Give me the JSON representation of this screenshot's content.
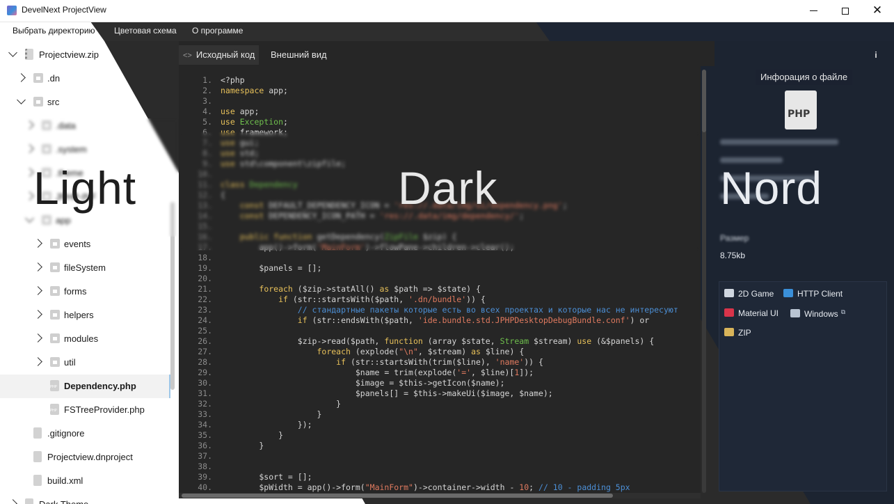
{
  "window": {
    "title": "DevelNext ProjectView",
    "minimize_glyph": "",
    "maximize_glyph": "",
    "close_glyph": "✕"
  },
  "menu": {
    "items": [
      "Выбрать директорию",
      "Цветовая схема",
      "О программе"
    ]
  },
  "tree": {
    "items": [
      {
        "label": "Projectview.zip",
        "type": "zip"
      },
      {
        "label": ".dn",
        "type": "folder"
      },
      {
        "label": "src",
        "type": "folder"
      },
      {
        "label": ".data",
        "type": "folder"
      },
      {
        "label": ".system",
        "type": "folder"
      },
      {
        "label": ".theme",
        "type": "folder"
      },
      {
        "label": "JPHP-INF",
        "type": "folder"
      },
      {
        "label": "app",
        "type": "folder"
      },
      {
        "label": "events",
        "type": "folder"
      },
      {
        "label": "fileSystem",
        "type": "folder"
      },
      {
        "label": "forms",
        "type": "folder"
      },
      {
        "label": "helpers",
        "type": "folder"
      },
      {
        "label": "modules",
        "type": "folder"
      },
      {
        "label": "util",
        "type": "folder"
      },
      {
        "label": "Dependency.php",
        "type": "php",
        "selected": true
      },
      {
        "label": "FSTreeProvider.php",
        "type": "php"
      },
      {
        "label": ".gitignore",
        "type": "doc"
      },
      {
        "label": "Projectview.dnproject",
        "type": "doc"
      },
      {
        "label": "build.xml",
        "type": "doc"
      },
      {
        "label": "Dark Theme",
        "type": "doc"
      }
    ]
  },
  "tabs": {
    "source": "Исходный код",
    "source_icon": "<>",
    "view": "Внешний вид"
  },
  "info": {
    "button": "i",
    "title": "Инфорация о файле",
    "file_type": "PHP",
    "size_label": "Размер",
    "size_value": "8.75kb",
    "plugins": [
      {
        "label": "2D Game",
        "icon": "gamepad-icon"
      },
      {
        "label": "HTTP Client",
        "icon": "http-icon"
      },
      {
        "label": "Material UI",
        "icon": "material-icon"
      },
      {
        "label": "Windows",
        "icon": "windows-icon",
        "ext": "⧉"
      },
      {
        "label": "ZIP",
        "icon": "zip-icon"
      }
    ]
  },
  "themes": {
    "light": "Light",
    "dark": "Dark",
    "nord": "Nord"
  },
  "code": [
    {
      "n": "1.",
      "t": [
        [
          "",
          "<?php"
        ]
      ]
    },
    {
      "n": "2.",
      "t": [
        [
          "kw",
          "namespace"
        ],
        [
          "",
          " app;"
        ]
      ]
    },
    {
      "n": "3.",
      "t": []
    },
    {
      "n": "4.",
      "t": [
        [
          "kw",
          "use"
        ],
        [
          "",
          " app;"
        ]
      ]
    },
    {
      "n": "5.",
      "t": [
        [
          "kw",
          "use"
        ],
        [
          "cls",
          " Exception"
        ],
        [
          "",
          ";"
        ]
      ]
    },
    {
      "n": "6.",
      "t": [
        [
          "kw",
          "use"
        ],
        [
          "",
          " framework;"
        ]
      ]
    },
    {
      "n": "7.",
      "t": [
        [
          "kw",
          "use"
        ],
        [
          "",
          " gui;"
        ]
      ]
    },
    {
      "n": "8.",
      "t": [
        [
          "kw",
          "use"
        ],
        [
          "",
          " std;"
        ]
      ]
    },
    {
      "n": "9.",
      "t": [
        [
          "kw",
          "use"
        ],
        [
          "",
          " std\\component\\zipfile;"
        ]
      ]
    },
    {
      "n": "10.",
      "t": []
    },
    {
      "n": "11.",
      "t": [
        [
          "kw",
          "class"
        ],
        [
          "cls",
          " Dependency"
        ]
      ]
    },
    {
      "n": "12.",
      "t": [
        [
          "",
          "{"
        ]
      ]
    },
    {
      "n": "13.",
      "t": [
        [
          "",
          "    "
        ],
        [
          "kw",
          "const"
        ],
        [
          "",
          " DEFAULT_DEPENDENCY_ICON = "
        ],
        [
          "str",
          "'res://.data/img/ui/dependency.png'"
        ],
        [
          "",
          ";"
        ]
      ]
    },
    {
      "n": "14.",
      "t": [
        [
          "",
          "    "
        ],
        [
          "kw",
          "const"
        ],
        [
          "",
          " DEPENDENCY_ICON_PATH = "
        ],
        [
          "str",
          "'res://.data/img/dependency/'"
        ],
        [
          "",
          ";"
        ]
      ]
    },
    {
      "n": "15.",
      "t": []
    },
    {
      "n": "16.",
      "t": [
        [
          "",
          "    "
        ],
        [
          "kw",
          "public function"
        ],
        [
          "",
          " getDependency("
        ],
        [
          "cls",
          "ZipFile"
        ],
        [
          "",
          " $zip) {"
        ]
      ]
    },
    {
      "n": "17.",
      "t": [
        [
          "",
          "        app()->form("
        ],
        [
          "str",
          "'MainForm'"
        ],
        [
          "",
          ")->flowPane->children->clear();"
        ]
      ]
    },
    {
      "n": "18.",
      "t": []
    },
    {
      "n": "19.",
      "t": [
        [
          "",
          "        $panels = [];"
        ]
      ]
    },
    {
      "n": "20.",
      "t": []
    },
    {
      "n": "21.",
      "t": [
        [
          "",
          "        "
        ],
        [
          "kw",
          "foreach"
        ],
        [
          "",
          " ($zip->statAll() "
        ],
        [
          "kw",
          "as"
        ],
        [
          "",
          " $path => $state) {"
        ]
      ]
    },
    {
      "n": "22.",
      "t": [
        [
          "",
          "            "
        ],
        [
          "kw",
          "if"
        ],
        [
          "",
          " (str::startsWith($path, "
        ],
        [
          "str",
          "'.dn/bundle'"
        ],
        [
          "",
          ")) {"
        ]
      ]
    },
    {
      "n": "23.",
      "t": [
        [
          "cm",
          "                // стандартные пакеты которые есть во всех проектах и которые нас не интересуют"
        ]
      ]
    },
    {
      "n": "24.",
      "t": [
        [
          "",
          "                "
        ],
        [
          "kw",
          "if"
        ],
        [
          "",
          " (str::endsWith($path, "
        ],
        [
          "str",
          "'ide.bundle.std.JPHPDesktopDebugBundle.conf'"
        ],
        [
          "",
          ") or"
        ]
      ]
    },
    {
      "n": "25.",
      "t": []
    },
    {
      "n": "26.",
      "t": [
        [
          "",
          "                $zip->read($path, "
        ],
        [
          "kw",
          "function"
        ],
        [
          "",
          " (array $state, "
        ],
        [
          "cls",
          "Stream"
        ],
        [
          "",
          " $stream) "
        ],
        [
          "kw",
          "use"
        ],
        [
          "",
          " (&$panels) {"
        ]
      ]
    },
    {
      "n": "27.",
      "t": [
        [
          "",
          "                    "
        ],
        [
          "kw",
          "foreach"
        ],
        [
          "",
          " (explode("
        ],
        [
          "str",
          "\"\\n\""
        ],
        [
          "",
          ", $stream) "
        ],
        [
          "kw",
          "as"
        ],
        [
          "",
          " $line) {"
        ]
      ]
    },
    {
      "n": "28.",
      "t": [
        [
          "",
          "                        "
        ],
        [
          "kw",
          "if"
        ],
        [
          "",
          " (str::startsWith(trim($line), "
        ],
        [
          "str",
          "'name'"
        ],
        [
          "",
          ")) {"
        ]
      ]
    },
    {
      "n": "29.",
      "t": [
        [
          "",
          "                            $name = trim(explode("
        ],
        [
          "str",
          "'='"
        ],
        [
          "",
          ", $line)["
        ],
        [
          "num",
          "1"
        ],
        [
          "",
          "]);"
        ]
      ]
    },
    {
      "n": "30.",
      "t": [
        [
          "",
          "                            $image = $this->getIcon($name);"
        ]
      ]
    },
    {
      "n": "31.",
      "t": [
        [
          "",
          "                            $panels[] = $this->makeUi($image, $name);"
        ]
      ]
    },
    {
      "n": "32.",
      "t": [
        [
          "",
          "                        }"
        ]
      ]
    },
    {
      "n": "33.",
      "t": [
        [
          "",
          "                    }"
        ]
      ]
    },
    {
      "n": "34.",
      "t": [
        [
          "",
          "                });"
        ]
      ]
    },
    {
      "n": "35.",
      "t": [
        [
          "",
          "            }"
        ]
      ]
    },
    {
      "n": "36.",
      "t": [
        [
          "",
          "        }"
        ]
      ]
    },
    {
      "n": "37.",
      "t": []
    },
    {
      "n": "38.",
      "t": []
    },
    {
      "n": "39.",
      "t": [
        [
          "",
          "        $sort = [];"
        ]
      ]
    },
    {
      "n": "40.",
      "t": [
        [
          "",
          "        $pWidth = app()->form("
        ],
        [
          "str",
          "\"MainForm\""
        ],
        [
          "",
          ")->container->width - "
        ],
        [
          "num",
          "10"
        ],
        [
          "",
          "; "
        ],
        [
          "cm",
          "// 10 - padding 5px"
        ]
      ]
    }
  ]
}
